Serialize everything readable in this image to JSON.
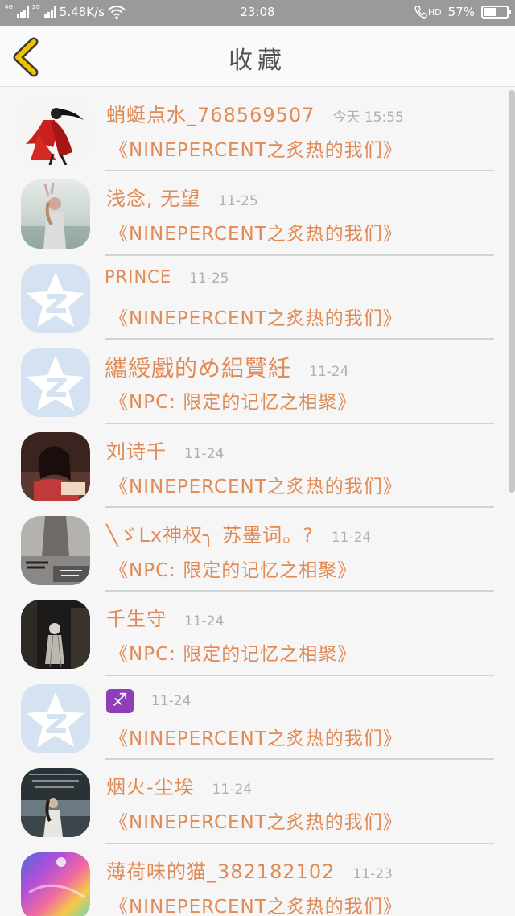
{
  "status_bar": {
    "signal1_label": "4G",
    "signal2_label": "2G",
    "speed": "5.48K/s",
    "time": "23:08",
    "hd_label": "HD",
    "battery_text": "57%",
    "battery_level": 0.57
  },
  "header": {
    "title": "收藏"
  },
  "colors": {
    "accent": "#e08a55",
    "back_arrow": "#f2c200",
    "meta_gray": "#b0b0b0"
  },
  "items": [
    {
      "name": "蛸蜓点水_768569507",
      "time": "今天 15:55",
      "comment": "《NINEPERCENT之炙热的我们》",
      "avatar": "photo-red-dress"
    },
    {
      "name": "浅念, 无望",
      "time": "11-25",
      "comment": "《NINEPERCENT之炙热的我们》",
      "avatar": "photo-misty-girl"
    },
    {
      "name": "PRINCE",
      "time": "11-25",
      "comment": "《NINEPERCENT之炙热的我们》",
      "avatar": "default-qq-star"
    },
    {
      "name": "纗綬戲的め絽贒紝",
      "time": "11-24",
      "comment": "《NPC: 限定的记忆之相聚》",
      "avatar": "default-qq-star"
    },
    {
      "name": "刘诗千",
      "time": "11-24",
      "comment": "《NINEPERCENT之炙热的我们》",
      "avatar": "photo-girl-dark"
    },
    {
      "name": "╲ゞLx神权╮ 苏墨词。?",
      "time": "11-24",
      "comment": "《NPC: 限定的记忆之相聚》",
      "avatar": "photo-gray-text"
    },
    {
      "name": "千生守",
      "time": "11-24",
      "comment": "《NPC: 限定的记忆之相聚》",
      "avatar": "photo-dark-figure"
    },
    {
      "name": "♐",
      "time": "11-24",
      "comment": "《NINEPERCENT之炙热的我们》",
      "avatar": "default-qq-star"
    },
    {
      "name": "烟火-尘埃",
      "time": "11-24",
      "comment": "《NINEPERCENT之炙热的我们》",
      "avatar": "photo-girl-sea"
    },
    {
      "name": "薄荷味的猫_382182102",
      "time": "11-23",
      "comment": "《NINEPERCENT之炙热的我们》",
      "avatar": "photo-rainbow"
    }
  ]
}
